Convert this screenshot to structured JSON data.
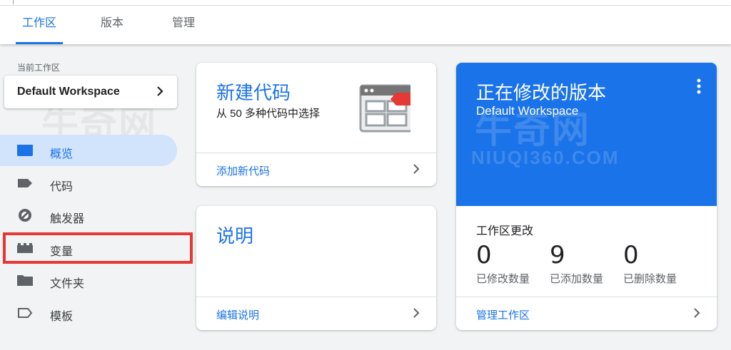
{
  "tabs": [
    {
      "label": "工作区",
      "active": true
    },
    {
      "label": "版本",
      "active": false
    },
    {
      "label": "管理",
      "active": false
    }
  ],
  "workspace": {
    "label": "当前工作区",
    "name": "Default Workspace"
  },
  "nav": [
    {
      "label": "概览",
      "icon": "overview-icon",
      "active": true
    },
    {
      "label": "代码",
      "icon": "tag-icon",
      "active": false
    },
    {
      "label": "触发器",
      "icon": "trigger-icon",
      "active": false
    },
    {
      "label": "变量",
      "icon": "variable-icon",
      "active": false,
      "highlighted": true
    },
    {
      "label": "文件夹",
      "icon": "folder-icon",
      "active": false
    },
    {
      "label": "模板",
      "icon": "template-icon",
      "active": false
    }
  ],
  "new_tag_card": {
    "title": "新建代码",
    "subtitle": "从 50 多种代码中选择",
    "link": "添加新代码"
  },
  "description_card": {
    "title": "说明",
    "link": "编辑说明"
  },
  "version_card": {
    "title": "正在修改的版本",
    "subtitle": "Default Workspace",
    "changes_label": "工作区更改",
    "stats": [
      {
        "value": "0",
        "label": "已修改数量"
      },
      {
        "value": "9",
        "label": "已添加数量"
      },
      {
        "value": "0",
        "label": "已删除数量"
      }
    ],
    "link": "管理工作区"
  },
  "watermark": {
    "cn": "牛奇网",
    "en": "NIUQI360.COM"
  },
  "colors": {
    "accent": "#1a73e8",
    "highlight": "#e53935",
    "active_nav_bg": "#d2e3fc"
  }
}
